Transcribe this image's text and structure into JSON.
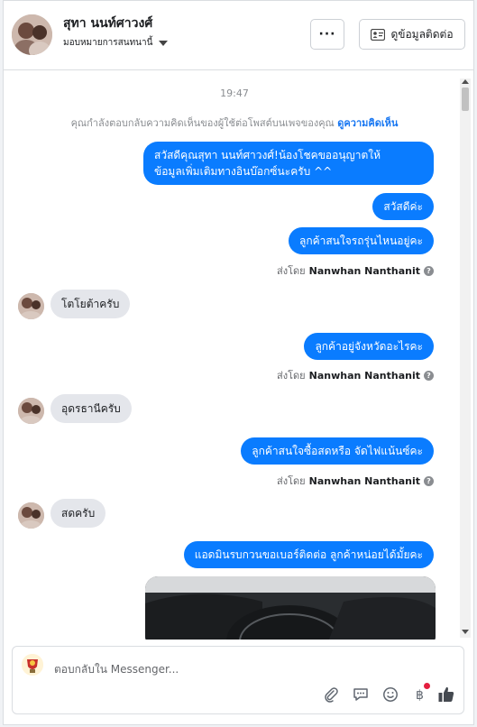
{
  "header": {
    "name": "สุทา นนท์ศาวงศ์",
    "assign_label": "มอบหมายการสนทนานี้",
    "more_label": "···",
    "contact_label": "ดูข้อมูลติดต่อ"
  },
  "conversation": {
    "time": "19:47",
    "notice_text": "คุณกำลังตอบกลับความคิดเห็นของผู้ใช้ต่อโพสต์บนเพจของคุณ",
    "notice_link": "ดูความคิดเห็น",
    "messages": [
      {
        "from": "page",
        "lines": [
          "สวัสดีคุณสุทา นนท์ศาวงศ์!น้องโชคขออนุญาตให้",
          "ข้อมูลเพิ่มเติมทางอินบ๊อกซ์นะครับ ^^"
        ]
      },
      {
        "from": "page",
        "text": "สวัสดีค่ะ"
      },
      {
        "from": "page",
        "text": "ลูกค้าสนใจรถรุ่นไหนอยู่คะ",
        "sent_by_label": "ส่งโดย",
        "sent_by_name": "Nanwhan Nanthanit"
      },
      {
        "from": "customer",
        "text": "โตโยต้าครับ"
      },
      {
        "from": "page",
        "text": "ลูกค้าอยู่จังหวัดอะไรคะ",
        "sent_by_label": "ส่งโดย",
        "sent_by_name": "Nanwhan Nanthanit"
      },
      {
        "from": "customer",
        "text": "อุดรธานีครับ"
      },
      {
        "from": "page",
        "text": "ลูกค้าสนใจซื้อสดหรือ จัดไฟแน้นซ์คะ",
        "sent_by_label": "ส่งโดย",
        "sent_by_name": "Nanwhan Nanthanit"
      },
      {
        "from": "customer",
        "text": "สดครับ"
      },
      {
        "from": "page",
        "text": "แอดมินรบกวนขอเบอร์ติดต่อ ลูกค้าหน่อยได้มั้ยคะ"
      }
    ]
  },
  "composer": {
    "placeholder": "ตอบกลับใน Messenger...",
    "tools": [
      "paperclip-icon",
      "chat-bubble-icon",
      "smiley-icon",
      "baht-icon",
      "thumbs-up-icon"
    ]
  },
  "colors": {
    "outgoing_bubble": "#0a7cff",
    "incoming_bubble": "#e4e6eb",
    "link": "#1877f2",
    "badge": "#e41e3f"
  }
}
